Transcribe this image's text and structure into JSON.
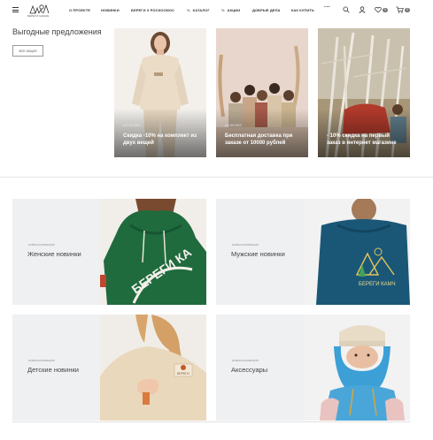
{
  "header": {
    "logo_text": "БЕРЕГИ ЦИНАЕ",
    "nav": [
      {
        "label": "О проекте"
      },
      {
        "label": "Новинки"
      },
      {
        "label": "Береги х Роскосмос"
      },
      {
        "label": "Каталог",
        "prefix": "%"
      },
      {
        "label": "Акции",
        "prefix": "%"
      },
      {
        "label": "Добрые дела"
      },
      {
        "label": "Как купить"
      }
    ],
    "more": "···",
    "favorites_count": "0",
    "cart_count": "0"
  },
  "promo": {
    "title": "Выгодные предложения",
    "button_label": "ВСЕ АКЦИИ",
    "cards": [
      {
        "date": "01.02.2022",
        "caption": "Скидка -10% на комплект из двух вещей"
      },
      {
        "date": "11.09.2022",
        "caption": "Бесплатная доставка при заказе от 10000 рублей"
      },
      {
        "date": "",
        "caption": "- 10% скидка на первый заказ в интернет магазине"
      }
    ]
  },
  "categories": [
    {
      "sub": "Новая коллекция",
      "name": "Женские новинки"
    },
    {
      "sub": "Новая коллекция",
      "name": "Мужские новинки"
    },
    {
      "sub": "Новая коллекция",
      "name": "Детские новинки"
    },
    {
      "sub": "Новая коллекция",
      "name": "Аксессуары"
    }
  ],
  "photo_texts": {
    "green_hoodie": "БЕРЕГИ КА",
    "blue_hoodie": "БЕРЕГИ КАМЧ",
    "beige_patch": "БЕРЕГИ"
  },
  "colors": {
    "accent": "#333333",
    "badge": "#777777",
    "card_bg": "#eff0f2"
  }
}
